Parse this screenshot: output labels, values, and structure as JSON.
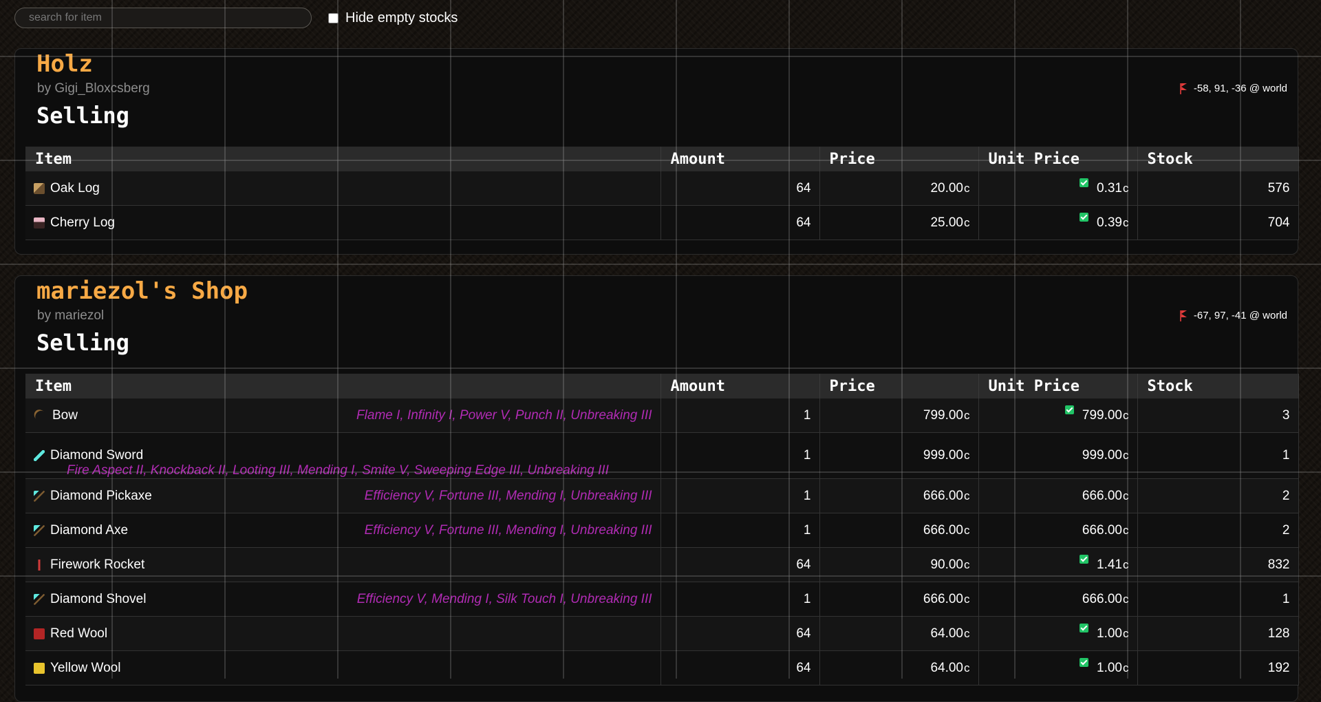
{
  "search": {
    "placeholder": "search for item",
    "value": ""
  },
  "filter": {
    "hide_empty_label": "Hide empty stocks",
    "checked": false
  },
  "table_headers": [
    "Item",
    "Amount",
    "Price",
    "Unit Price",
    "Stock"
  ],
  "currency_symbol": "c",
  "colors": {
    "title": "#f7a945",
    "enchant": "#b12bb4",
    "low_stock": "#ff3b3b",
    "check": "#21c466"
  },
  "shops": [
    {
      "name": "Holz",
      "owner": "by Gigi_Bloxcsberg",
      "location": "-58, 91, -36 @ world",
      "section": "Selling",
      "items": [
        {
          "icon": "oak-log-icon",
          "name": "Oak Log",
          "enchantments": "",
          "amount": "64",
          "price": "20.00",
          "unit_price": "0.31",
          "unit_check": true,
          "stock": "576",
          "low": false
        },
        {
          "icon": "cherry-log-icon",
          "name": "Cherry Log",
          "enchantments": "",
          "amount": "64",
          "price": "25.00",
          "unit_price": "0.39",
          "unit_check": true,
          "stock": "704",
          "low": false
        }
      ]
    },
    {
      "name": "mariezol's Shop",
      "owner": "by mariezol",
      "location": "-67, 97, -41 @ world",
      "section": "Selling",
      "items": [
        {
          "icon": "bow-icon",
          "name": "Bow",
          "enchantments": "Flame I, Infinity I, Power V, Punch II, Unbreaking III",
          "amount": "1",
          "price": "799.00",
          "unit_price": "799.00",
          "unit_check": true,
          "stock": "3",
          "low": true
        },
        {
          "icon": "diamond-sword-icon",
          "name": "Diamond Sword",
          "enchantments": "Fire Aspect II, Knockback II, Looting III, Mending I, Smite V, Sweeping Edge III, Unbreaking III",
          "amount": "1",
          "price": "999.00",
          "unit_price": "999.00",
          "unit_check": false,
          "stock": "1",
          "low": true
        },
        {
          "icon": "diamond-pickaxe-icon",
          "name": "Diamond Pickaxe",
          "enchantments": "Efficiency V, Fortune III, Mending I, Unbreaking III",
          "amount": "1",
          "price": "666.00",
          "unit_price": "666.00",
          "unit_check": false,
          "stock": "2",
          "low": true
        },
        {
          "icon": "diamond-axe-icon",
          "name": "Diamond Axe",
          "enchantments": "Efficiency V, Fortune III, Mending I, Unbreaking III",
          "amount": "1",
          "price": "666.00",
          "unit_price": "666.00",
          "unit_check": false,
          "stock": "2",
          "low": true
        },
        {
          "icon": "firework-rocket-icon",
          "name": "Firework Rocket",
          "enchantments": "",
          "amount": "64",
          "price": "90.00",
          "unit_price": "1.41",
          "unit_check": true,
          "stock": "832",
          "low": false
        },
        {
          "icon": "diamond-shovel-icon",
          "name": "Diamond Shovel",
          "enchantments": "Efficiency V, Mending I, Silk Touch I, Unbreaking III",
          "amount": "1",
          "price": "666.00",
          "unit_price": "666.00",
          "unit_check": false,
          "stock": "1",
          "low": true
        },
        {
          "icon": "red-wool-icon",
          "name": "Red Wool",
          "enchantments": "",
          "amount": "64",
          "price": "64.00",
          "unit_price": "1.00",
          "unit_check": true,
          "stock": "128",
          "low": false
        },
        {
          "icon": "yellow-wool-icon",
          "name": "Yellow Wool",
          "enchantments": "",
          "amount": "64",
          "price": "64.00",
          "unit_price": "1.00",
          "unit_check": true,
          "stock": "192",
          "low": false
        }
      ]
    }
  ]
}
